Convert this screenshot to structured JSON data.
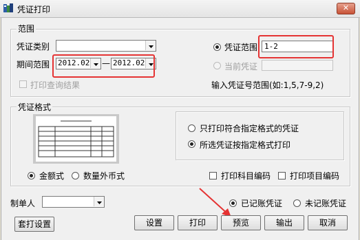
{
  "window": {
    "title": "凭证打印",
    "close_label": "✕"
  },
  "range_group": {
    "label": "范围",
    "voucher_type_label": "凭证类别",
    "voucher_type_value": "",
    "period_label": "期间范围",
    "period_from": "2012.02",
    "period_sep": "—",
    "period_to": "2012.02",
    "print_query_result_label": "打印查询结果",
    "voucher_range_label": "凭证范围",
    "voucher_range_value": "1-2",
    "current_voucher_label": "当前凭证",
    "current_voucher_value": "",
    "range_hint": "输入凭证号范围(如:1,5,7-9,2)"
  },
  "format_group": {
    "label": "凭证格式",
    "only_matching_label": "只打印符合指定格式的凭证",
    "all_selected_label": "所选凭证按指定格式打印",
    "amount_label": "金额式",
    "foreign_qty_label": "数量外币式",
    "print_subject_code_label": "打印科目编码",
    "print_item_code_label": "打印项目编码"
  },
  "maker": {
    "label": "制单人",
    "value": ""
  },
  "posted": {
    "posted_label": "已记账凭证",
    "unposted_label": "未记账凭证"
  },
  "buttons": {
    "template_settings": "套打设置",
    "settings": "设置",
    "print": "打印",
    "preview": "预览",
    "export": "输出",
    "cancel": "取消"
  },
  "colors": {
    "highlight": "#e53333",
    "window_bg": "#f0f0f0"
  }
}
